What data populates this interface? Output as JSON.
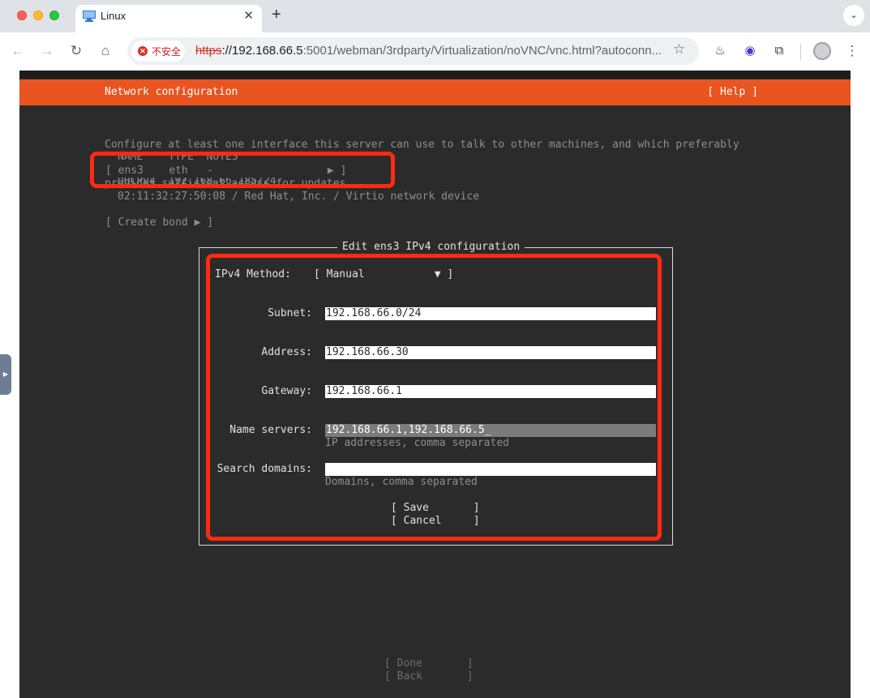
{
  "browser": {
    "tab_title": "Linux",
    "tab_close": "✕",
    "new_tab": "+",
    "tabs_menu": "⌄",
    "nav": {
      "back": "←",
      "forward": "→",
      "reload": "↻",
      "home": "⌂"
    },
    "security_label": "不安全",
    "url_scheme": "https",
    "url_host": "://192.168.66.5",
    "url_rest": ":5001/webman/3rdparty/Virtualization/noVNC/vnc.html?autoconn...",
    "bookmark": "☆",
    "extensions": [
      "♨",
      "◉",
      "⧉"
    ],
    "menu": "⋮"
  },
  "installer": {
    "header_title": "Network configuration",
    "help": "[ Help ]",
    "description_line1": "Configure at least one interface this server can use to talk to other machines, and which preferably",
    "description_line2": "provides sufficient access for updates.",
    "interfaces_header": "NAME    TYPE  NOTES",
    "interface_row": "[ ens3    eth   -                  ▶ ]",
    "interface_dhcp": "DHCPv4  192.168.66.185/24",
    "interface_mac": "02:11:32:27:50:08 / Red Hat, Inc. / Virtio network device",
    "create_bond": "[ Create bond ▶ ]",
    "done": "[ Done       ]",
    "back": "[ Back       ]"
  },
  "dialog": {
    "title": "Edit ens3 IPv4 configuration",
    "method_label": "IPv4 Method:",
    "method_value": "[ Manual           ▼ ]",
    "subnet_label": "Subnet:",
    "subnet_value": "192.168.66.0/24",
    "address_label": "Address:",
    "address_value": "192.168.66.30",
    "gateway_label": "Gateway:",
    "gateway_value": "192.168.66.1",
    "nameservers_label": "Name servers:",
    "nameservers_value": "192.168.66.1,192.168.66.5_",
    "nameservers_hint": "IP addresses, comma separated",
    "search_label": "Search domains:",
    "search_value": "",
    "search_hint": "Domains, comma separated",
    "save": "[ Save       ]",
    "cancel": "[ Cancel     ]"
  },
  "colors": {
    "ubuntu_orange": "#e95420",
    "highlight_red": "#ff2a12",
    "terminal_bg": "#2b2b2b"
  }
}
